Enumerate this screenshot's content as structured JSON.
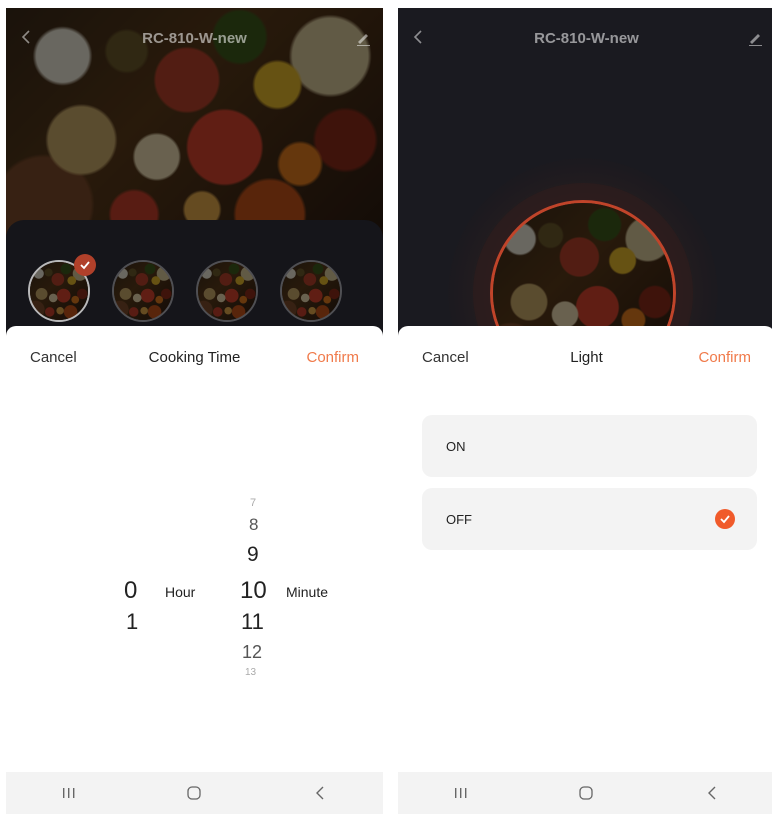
{
  "left": {
    "header": {
      "title": "RC-810-W-new"
    },
    "sheet": {
      "cancel": "Cancel",
      "title": "Cooking Time",
      "confirm": "Confirm"
    },
    "picker": {
      "hour_values": [
        "0",
        "1"
      ],
      "hour_unit": "Hour",
      "minute_values": [
        "7",
        "8",
        "9",
        "10",
        "11",
        "12",
        "13"
      ],
      "minute_unit": "Minute",
      "selected_hour": "0",
      "selected_minute": "10"
    }
  },
  "right": {
    "header": {
      "title": "RC-810-W-new"
    },
    "sheet": {
      "cancel": "Cancel",
      "title": "Light",
      "confirm": "Confirm"
    },
    "options": [
      {
        "label": "ON",
        "selected": false
      },
      {
        "label": "OFF",
        "selected": true
      }
    ]
  },
  "colors": {
    "accent": "#f07a4a",
    "check": "#f05a2a"
  },
  "icons": [
    "back-arrow-icon",
    "edit-pencil-icon",
    "check-icon",
    "nav-recents-icon",
    "nav-home-icon",
    "nav-back-icon"
  ]
}
